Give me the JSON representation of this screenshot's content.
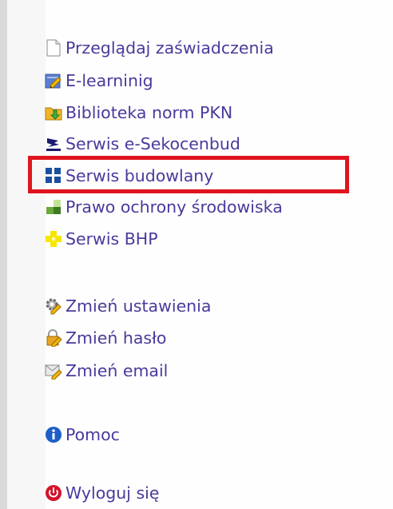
{
  "menu": {
    "items": [
      {
        "label": "Przeglądaj zaświadczenia",
        "icon": "document-icon"
      },
      {
        "label": "E-learninig",
        "icon": "edit-pencil-icon"
      },
      {
        "label": "Biblioteka norm PKN",
        "icon": "folder-download-icon"
      },
      {
        "label": "Serwis e-Sekocenbud",
        "icon": "sekocenbud-logo-icon"
      },
      {
        "label": "Serwis budowlany",
        "icon": "blue-squares-icon"
      },
      {
        "label": "Prawo ochrony środowiska",
        "icon": "green-squares-icon"
      },
      {
        "label": "Serwis BHP",
        "icon": "yellow-squares-icon"
      },
      {
        "label": "Zmień ustawienia",
        "icon": "settings-pencil-icon"
      },
      {
        "label": "Zmień hasło",
        "icon": "lock-pencil-icon"
      },
      {
        "label": "Zmień email",
        "icon": "envelope-pencil-icon"
      },
      {
        "label": "Pomoc",
        "icon": "info-icon"
      },
      {
        "label": "Wyloguj się",
        "icon": "power-icon"
      }
    ]
  },
  "highlight": {
    "target": "Serwis budowlany",
    "color": "#e0141e"
  },
  "colors": {
    "link": "#4a3a9c",
    "background": "#ffffff",
    "strip": "#d9d9d9"
  }
}
